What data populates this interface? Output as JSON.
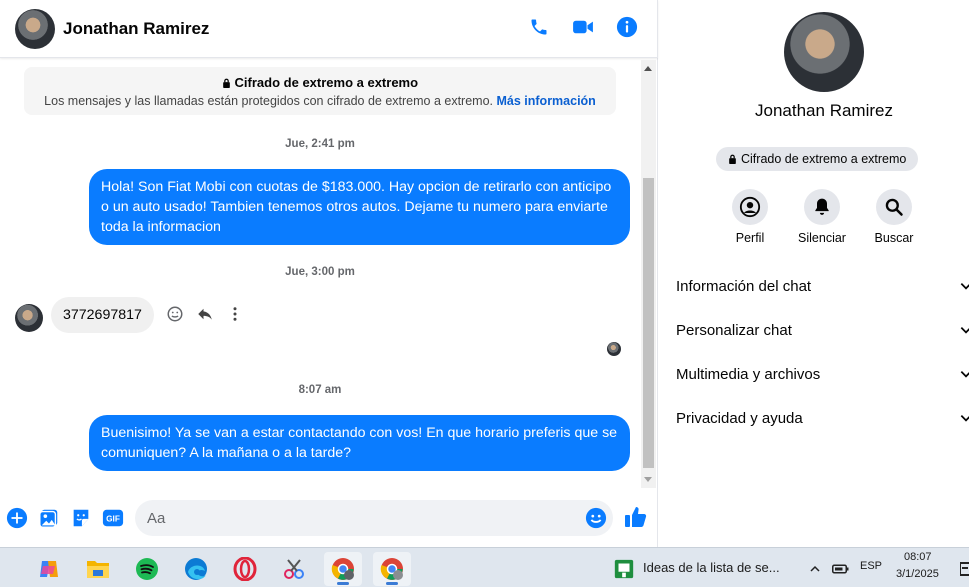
{
  "chat": {
    "contact_name": "Jonathan Ramirez",
    "e2e_banner": {
      "title": "Cifrado de extremo a extremo",
      "subtitle": "Los mensajes y las llamadas están protegidos con cifrado de extremo a extremo.",
      "link": "Más información"
    },
    "messages": [
      {
        "type": "timestamp",
        "text": "Jue, 2:41 pm"
      },
      {
        "type": "outgoing",
        "text": "Hola! Son Fiat Mobi con cuotas de $183.000. Hay opcion de retirarlo con anticipo o un auto usado! Tambien tenemos otros autos. Dejame tu numero para enviarte toda la informacion"
      },
      {
        "type": "timestamp",
        "text": "Jue, 3:00 pm"
      },
      {
        "type": "incoming",
        "text": "3772697817"
      },
      {
        "type": "timestamp",
        "text": "8:07 am"
      },
      {
        "type": "outgoing",
        "text": "Buenisimo! Ya se van a estar contactando con vos! En que horario preferis que se comuniquen? A la mañana o a la tarde?"
      }
    ],
    "composer_placeholder": "Aa"
  },
  "info": {
    "name": "Jonathan Ramirez",
    "e2e_label": "Cifrado de extremo a extremo",
    "actions": [
      {
        "label": "Perfil",
        "icon": "profile-icon"
      },
      {
        "label": "Silenciar",
        "icon": "bell-icon"
      },
      {
        "label": "Buscar",
        "icon": "search-icon"
      }
    ],
    "sections": [
      "Información del chat",
      "Personalizar chat",
      "Multimedia y archivos",
      "Privacidad y ayuda"
    ]
  },
  "taskbar": {
    "window_title": "Ideas de la lista de se...",
    "language": "ESP",
    "time": "08:07",
    "date": "3/1/2025"
  },
  "colors": {
    "accent": "#0a7cff",
    "link": "#0a5fd1",
    "incoming_bubble": "#f0f0f0"
  }
}
